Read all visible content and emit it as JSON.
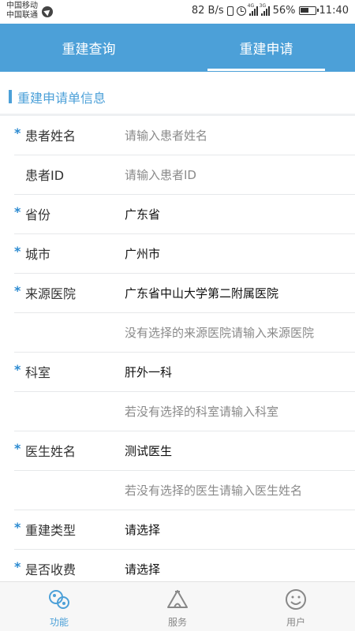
{
  "status_bar": {
    "carrier1": "中国移动",
    "carrier2": "中国联通",
    "speed": "82 B/s",
    "battery": "56%",
    "time": "11:40",
    "net1": "4G",
    "net2": "3G"
  },
  "header": {
    "tabs": [
      {
        "label": "重建查询",
        "active": false
      },
      {
        "label": "重建申请",
        "active": true
      }
    ]
  },
  "section": {
    "title": "重建申请单信息"
  },
  "form": {
    "rows": [
      {
        "label": "患者姓名",
        "required": true,
        "value": "",
        "placeholder": "请输入患者姓名"
      },
      {
        "label": "患者ID",
        "required": false,
        "value": "",
        "placeholder": "请输入患者ID"
      },
      {
        "label": "省份",
        "required": true,
        "value": "广东省",
        "placeholder": ""
      },
      {
        "label": "城市",
        "required": true,
        "value": "广州市",
        "placeholder": ""
      },
      {
        "label": "来源医院",
        "required": true,
        "value": "广东省中山大学第二附属医院",
        "placeholder": ""
      },
      {
        "label": "",
        "required": false,
        "value": "",
        "placeholder": "没有选择的来源医院请输入来源医院"
      },
      {
        "label": "科室",
        "required": true,
        "value": "肝外一科",
        "placeholder": ""
      },
      {
        "label": "",
        "required": false,
        "value": "",
        "placeholder": "若没有选择的科室请输入科室"
      },
      {
        "label": "医生姓名",
        "required": true,
        "value": "测试医生",
        "placeholder": ""
      },
      {
        "label": "",
        "required": false,
        "value": "",
        "placeholder": "若没有选择的医生请输入医生姓名"
      },
      {
        "label": "重建类型",
        "required": true,
        "value": "请选择",
        "placeholder": ""
      },
      {
        "label": "是否收费",
        "required": true,
        "value": "请选择",
        "placeholder": ""
      }
    ],
    "required_mark": "*"
  },
  "bottom_nav": {
    "items": [
      {
        "label": "功能",
        "icon": "function-icon",
        "active": true
      },
      {
        "label": "服务",
        "icon": "service-icon",
        "active": false
      },
      {
        "label": "用户",
        "icon": "user-icon",
        "active": false
      }
    ]
  },
  "colors": {
    "accent": "#4ca0d8",
    "required": "#2b8ad1"
  }
}
